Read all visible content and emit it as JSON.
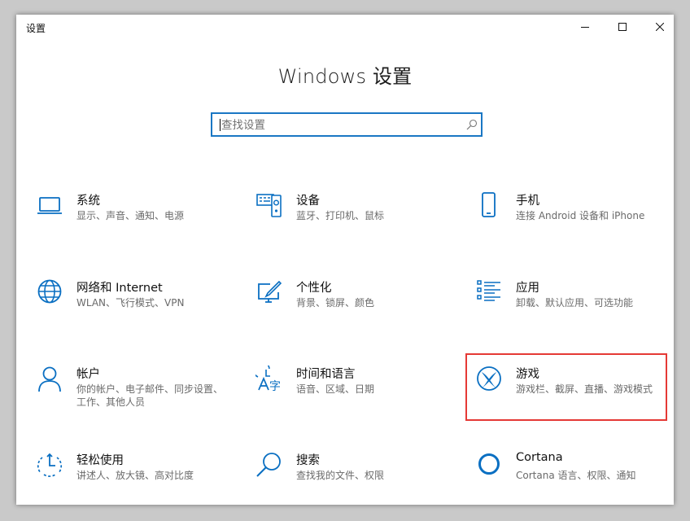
{
  "window": {
    "title": "设置"
  },
  "header": {
    "title": "Windows 设置"
  },
  "search": {
    "placeholder": "查找设置"
  },
  "colors": {
    "accent": "#0a6fc2",
    "highlight": "#e53935"
  },
  "tiles": [
    {
      "title": "系统",
      "desc": "显示、声音、通知、电源",
      "icon": "laptop-icon"
    },
    {
      "title": "设备",
      "desc": "蓝牙、打印机、鼠标",
      "icon": "devices-icon"
    },
    {
      "title": "手机",
      "desc": "连接 Android 设备和 iPhone",
      "icon": "phone-icon"
    },
    {
      "title": "网络和 Internet",
      "desc": "WLAN、飞行模式、VPN",
      "icon": "globe-icon"
    },
    {
      "title": "个性化",
      "desc": "背景、锁屏、颜色",
      "icon": "personalization-icon"
    },
    {
      "title": "应用",
      "desc": "卸载、默认应用、可选功能",
      "icon": "apps-list-icon"
    },
    {
      "title": "帐户",
      "desc": "你的帐户、电子邮件、同步设置、工作、其他人员",
      "icon": "person-icon"
    },
    {
      "title": "时间和语言",
      "desc": "语音、区域、日期",
      "icon": "time-language-icon"
    },
    {
      "title": "游戏",
      "desc": "游戏栏、截屏、直播、游戏模式",
      "icon": "xbox-icon"
    },
    {
      "title": "轻松使用",
      "desc": "讲述人、放大镜、高对比度",
      "icon": "ease-of-access-icon"
    },
    {
      "title": "搜索",
      "desc": "查找我的文件、权限",
      "icon": "search-magnifier-icon"
    },
    {
      "title": "Cortana",
      "desc": "Cortana 语言、权限、通知",
      "icon": "cortana-icon"
    }
  ]
}
